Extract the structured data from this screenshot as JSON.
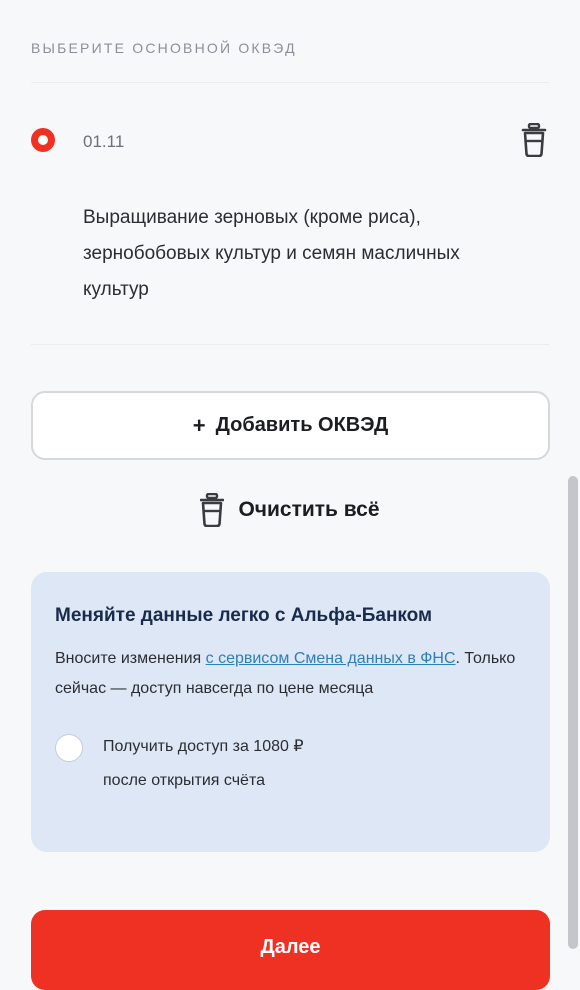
{
  "section": {
    "title": "Выберите основной ОКВЭД"
  },
  "okved": {
    "code": "01.11",
    "description": "Выращивание зерновых (кроме риса), зернобобовых культур и семян масличных культур"
  },
  "actions": {
    "add_label": "Добавить ОКВЭД",
    "clear_label": "Очистить всё"
  },
  "info_card": {
    "title": "Меняйте данные легко с Альфа-Банком",
    "text_before_link": "Вносите изменения ",
    "link_text": "с сервисом Смена данных в ФНС",
    "text_after_link": ". Только сейчас — доступ навсегда по цене месяца",
    "checkbox_label_line1": "Получить доступ за 1080 ₽",
    "checkbox_label_line2": "после открытия счёта"
  },
  "primary_button": {
    "label": "Далее"
  },
  "colors": {
    "accent": "#ef3124",
    "info_bg": "#dde7f5",
    "link": "#2e7fb6"
  }
}
